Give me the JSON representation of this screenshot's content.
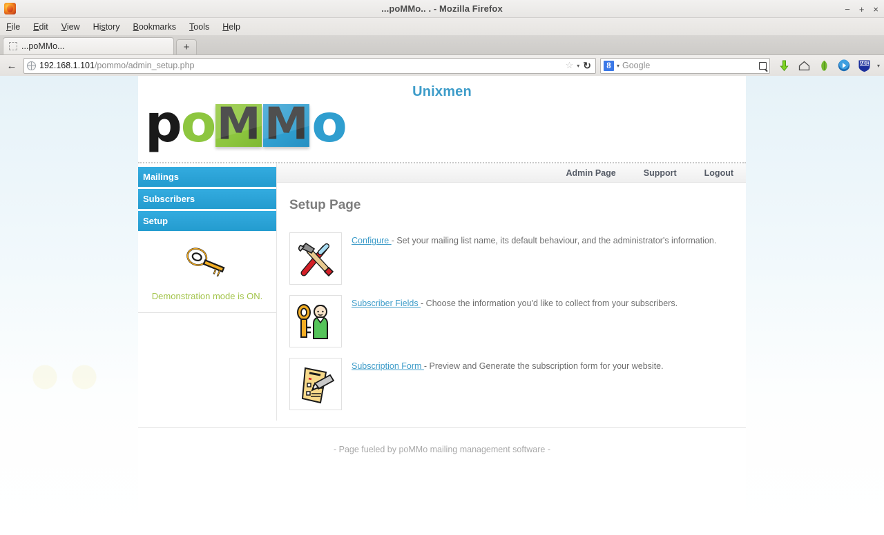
{
  "browser": {
    "window_title": "...poMMo.. . - Mozilla Firefox",
    "menus": [
      "File",
      "Edit",
      "View",
      "History",
      "Bookmarks",
      "Tools",
      "Help"
    ],
    "window_controls": {
      "minimize": "−",
      "maximize": "+",
      "close": "×"
    },
    "tab": {
      "label": "...poMMo...",
      "newtab_label": "+"
    },
    "url": {
      "host": "192.168.1.101",
      "path": "/pommo/admin_setup.php"
    },
    "search": {
      "engine": "g-icon",
      "placeholder": "Google"
    },
    "toolbar_icons": [
      "download-arrow-icon",
      "home-icon",
      "leaf-icon",
      "play-icon",
      "abe-shield-icon"
    ],
    "abe_label": "ABE",
    "back_glyph": "←",
    "reload_glyph": "↻",
    "star_glyph": "☆",
    "caret_glyph": "▾"
  },
  "page": {
    "site_title": "Unixmen",
    "logo": {
      "part1": "p",
      "part2": "o",
      "tile1": "M",
      "tile2": "M",
      "part3": "o",
      "accent_green": "#8dc63f",
      "accent_blue": "#2f9ecf"
    },
    "sidebar": {
      "nav": [
        {
          "label": "Mailings"
        },
        {
          "label": "Subscribers"
        },
        {
          "label": "Setup"
        }
      ],
      "demo_notice": "Demonstration mode is ON.",
      "demo_icon": "gold-key-icon",
      "demo_color": "#a2c44a"
    },
    "topnav": [
      {
        "label": "Admin Page"
      },
      {
        "label": "Support"
      },
      {
        "label": "Logout"
      }
    ],
    "main": {
      "heading": "Setup Page",
      "items": [
        {
          "icon": "hammer-and-screwdriver-icon",
          "link": "Configure ",
          "description": "- Set your mailing list name, its default behaviour, and the administrator's information."
        },
        {
          "icon": "key-and-person-icon",
          "link": "Subscriber Fields ",
          "description": "- Choose the information you'd like to collect from your subscribers."
        },
        {
          "icon": "form-with-pencil-icon",
          "link": "Subscription Form ",
          "description": "- Preview and Generate the subscription form for your website."
        }
      ]
    },
    "footer": "- Page fueled by poMMo mailing management software -"
  }
}
